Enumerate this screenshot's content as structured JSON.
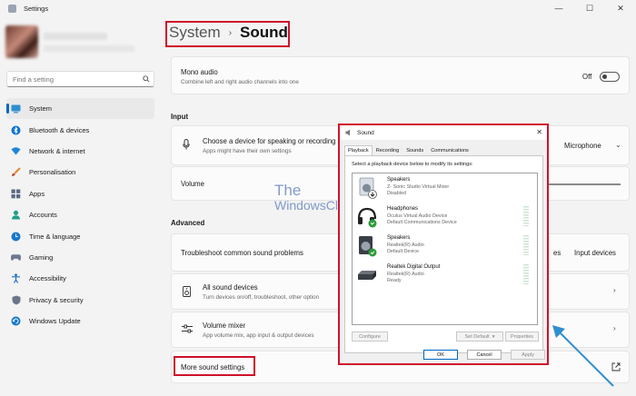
{
  "window": {
    "title": "Settings",
    "controls": [
      "—",
      "☐",
      "✕"
    ]
  },
  "search": {
    "placeholder": "Find a setting"
  },
  "sidebar": {
    "items": [
      {
        "label": "System",
        "icon": "monitor-icon",
        "active": true
      },
      {
        "label": "Bluetooth & devices",
        "icon": "bluetooth-icon"
      },
      {
        "label": "Network & internet",
        "icon": "wifi-icon"
      },
      {
        "label": "Personalisation",
        "icon": "brush-icon"
      },
      {
        "label": "Apps",
        "icon": "apps-icon"
      },
      {
        "label": "Accounts",
        "icon": "person-icon"
      },
      {
        "label": "Time & language",
        "icon": "globe-clock-icon"
      },
      {
        "label": "Gaming",
        "icon": "gamepad-icon"
      },
      {
        "label": "Accessibility",
        "icon": "accessibility-icon"
      },
      {
        "label": "Privacy & security",
        "icon": "shield-icon"
      },
      {
        "label": "Windows Update",
        "icon": "update-icon"
      }
    ]
  },
  "breadcrumb": {
    "parent": "System",
    "current": "Sound",
    "separator": "›"
  },
  "mono": {
    "title": "Mono audio",
    "desc": "Combine left and right audio channels into one",
    "state": "Off"
  },
  "input_section": {
    "label": "Input"
  },
  "input_device": {
    "title": "Choose a device for speaking or recording",
    "desc": "Apps might have their own settings",
    "value": "Microphone"
  },
  "volume": {
    "label": "Volume"
  },
  "advanced_section": {
    "label": "Advanced"
  },
  "troubleshoot": {
    "title": "Troubleshoot common sound problems",
    "output_btn_partial": "es",
    "input_btn": "Input devices"
  },
  "all_devices": {
    "title": "All sound devices",
    "desc": "Turn devices on/off, troubleshoot, other option"
  },
  "mixer": {
    "title": "Volume mixer",
    "desc": "App volume mix, app input & output devices"
  },
  "more": {
    "label": "More sound settings"
  },
  "watermark": {
    "line1": "The",
    "line2": "WindowsClub"
  },
  "dialog": {
    "title": "Sound",
    "tabs": [
      "Playback",
      "Recording",
      "Sounds",
      "Communications"
    ],
    "instruction": "Select a playback device below to modify its settings:",
    "devices": [
      {
        "name": "Speakers",
        "desc1": "Z- Sonic Studio Virtual Mixer",
        "desc2": "Disabled"
      },
      {
        "name": "Headphones",
        "desc1": "Oculus Virtual Audio Device",
        "desc2": "Default Communications Device"
      },
      {
        "name": "Speakers",
        "desc1": "Realtek(R) Audio",
        "desc2": "Default Device"
      },
      {
        "name": "Realtek Digital Output",
        "desc1": "Realtek(R) Audio",
        "desc2": "Ready"
      }
    ],
    "configure": "Configure",
    "set_default": "Set Default",
    "properties": "Properties",
    "ok": "OK",
    "cancel": "Cancel",
    "apply": "Apply"
  },
  "colors": {
    "accent": "#0067c0",
    "highlight": "#d0112b",
    "arrow": "#2f8ed1"
  }
}
